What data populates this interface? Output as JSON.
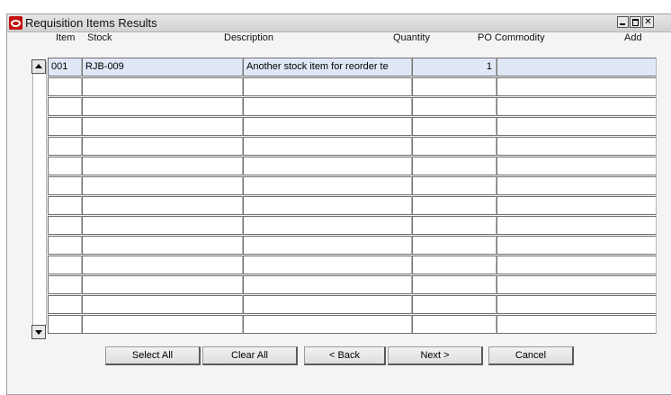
{
  "window": {
    "title": "Requisition Items Results"
  },
  "columns": {
    "item": "Item",
    "stock": "Stock",
    "description": "Description",
    "quantity": "Quantity",
    "po_commodity": "PO Commodity",
    "add": "Add"
  },
  "rows": [
    {
      "item": "001",
      "stock": "RJB-009",
      "description": "Another stock item for reorder te",
      "quantity": "1",
      "po_commodity": ""
    }
  ],
  "empty_row_count": 13,
  "buttons": {
    "select_all": "Select All",
    "clear_all": "Clear All",
    "back": "< Back",
    "next": "Next >",
    "cancel": "Cancel"
  },
  "colors": {
    "app_icon": "#c40f0f",
    "selected_row": "#e0e8f8"
  }
}
